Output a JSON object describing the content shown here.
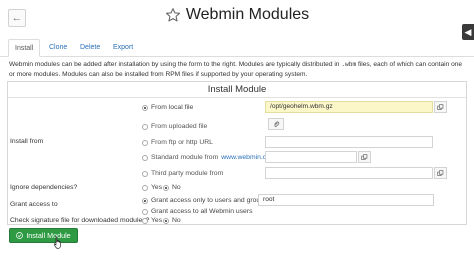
{
  "header": {
    "title": "Webmin Modules",
    "back_icon": "arrow-left-icon",
    "favorite_icon": "star-icon"
  },
  "tabs": [
    "Install",
    "Clone",
    "Delete",
    "Export"
  ],
  "description": {
    "part1": "Webmin modules can be added after installation by using the form to the right. Modules are typically distributed in ",
    "code": ".wbm",
    "part2": " files, each of which can contain one or more modules. Modules can also be installed from RPM files if supported by your operating system."
  },
  "panel": {
    "title": "Install Module",
    "install_from": {
      "label": "Install from",
      "local_file": {
        "label": "From local file",
        "value": "/opt/geohelm.wbm.gz"
      },
      "uploaded_file": {
        "label": "From uploaded file"
      },
      "ftp": {
        "label": "From ftp or http URL",
        "value": ""
      },
      "standard": {
        "label": "Standard module from",
        "link": "www.webmin.com",
        "value": ""
      },
      "third_party": {
        "label": "Third party module from",
        "value": ""
      }
    },
    "ignore_deps": {
      "label": "Ignore dependencies?",
      "yes": "Yes",
      "no": "No"
    },
    "grant_access": {
      "label": "Grant access to",
      "option_users": "Grant access only to users and groups :",
      "users_value": "root",
      "option_all": "Grant access to all Webmin users"
    },
    "check_signature": {
      "label": "Check signature file for downloaded modules?",
      "yes": "Yes",
      "no": "No"
    }
  },
  "install_button": {
    "label": "Install Module"
  },
  "colors": {
    "accent_link": "#2a6fb7",
    "install_button": "#2f9a44",
    "highlight_field": "#fbf7c9"
  }
}
